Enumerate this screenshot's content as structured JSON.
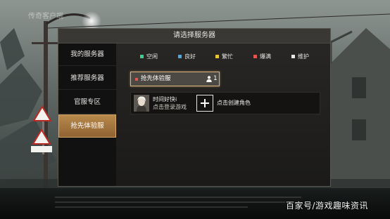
{
  "watermark_top": "传奇客户端",
  "dialog": {
    "title": "请选择服务器"
  },
  "sidebar": {
    "items": [
      {
        "label": "我的服务器",
        "active": false
      },
      {
        "label": "推荐服务器",
        "active": false
      },
      {
        "label": "官服专区",
        "active": false
      },
      {
        "label": "抢先体验服",
        "active": true
      }
    ]
  },
  "legend": [
    {
      "label": "空闲",
      "color": "#3ccf8e"
    },
    {
      "label": "良好",
      "color": "#4aa8e8"
    },
    {
      "label": "繁忙",
      "color": "#e8c43a"
    },
    {
      "label": "爆满",
      "color": "#e35652"
    },
    {
      "label": "维护",
      "color": "#e8e8e8"
    }
  ],
  "server": {
    "name": "抢先体验服",
    "player_count": "1",
    "status_color": "#e35652"
  },
  "character": {
    "name": "时间好快i",
    "hint": "点击登录游戏",
    "create_label": "点击创建角色"
  },
  "corner_watermark": "百家号/游戏趣味资讯"
}
